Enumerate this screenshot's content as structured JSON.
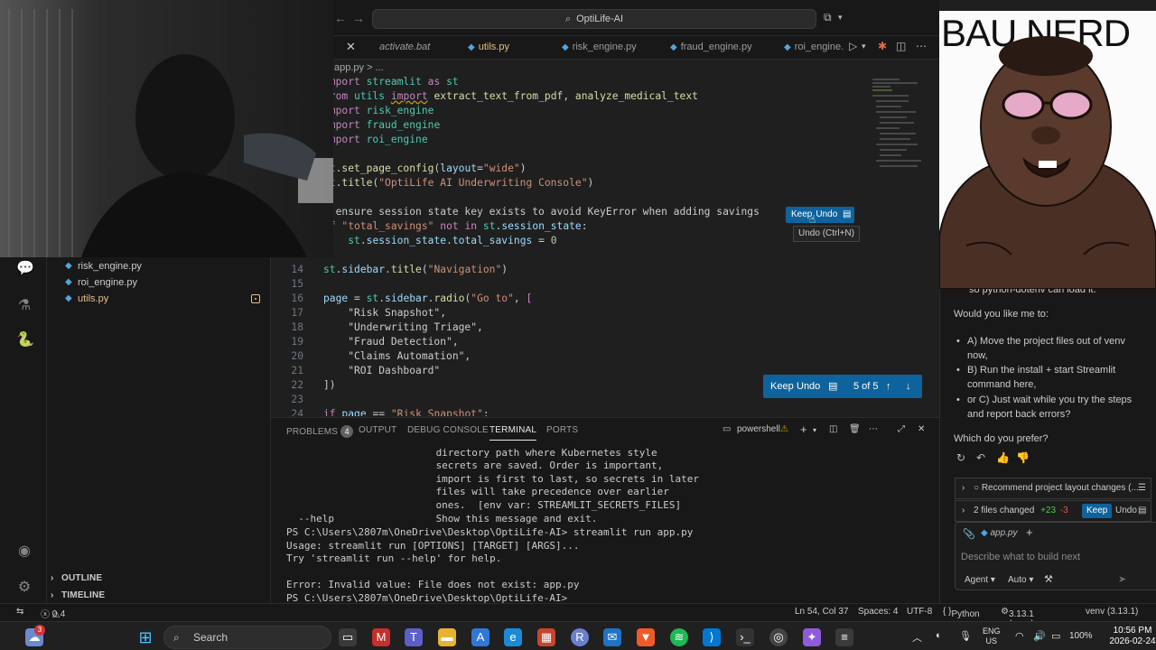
{
  "titlebar": {
    "search_text": "OptiLife-AI"
  },
  "tabs": [
    {
      "label": "activate.bat",
      "italic": true
    },
    {
      "label": "utils.py",
      "modified": true
    },
    {
      "label": "risk_engine.py"
    },
    {
      "label": "fraud_engine.py"
    },
    {
      "label": "roi_engine."
    }
  ],
  "breadcrumb": "app.py > ...",
  "explorer": {
    "files": [
      {
        "name": "risk_engine.py"
      },
      {
        "name": "roi_engine.py"
      },
      {
        "name": "utils.py",
        "modified": true
      }
    ],
    "sections": [
      "OUTLINE",
      "TIMELINE"
    ]
  },
  "editor": {
    "lines": [
      {
        "num": "",
        "code": "import streamlit as st"
      },
      {
        "num": "",
        "code": "from utils import extract_text_from_pdf, analyze_medical_text"
      },
      {
        "num": "",
        "code": "import risk_engine"
      },
      {
        "num": "",
        "code": "import fraud_engine"
      },
      {
        "num": "",
        "code": "import roi_engine"
      },
      {
        "num": "",
        "code": ""
      },
      {
        "num": "",
        "code": "st.set_page_config(layout=\"wide\")"
      },
      {
        "num": "",
        "code": "st.title(\"OptiLife AI Underwriting Console\")"
      },
      {
        "num": "",
        "code": ""
      },
      {
        "num": "",
        "code": "# ensure session state key exists to avoid KeyError when adding savings"
      },
      {
        "num": "",
        "code": "if \"total_savings\" not in st.session_state:"
      },
      {
        "num": "",
        "code": "    st.session_state.total_savings = 0"
      },
      {
        "num": "",
        "code": ""
      },
      {
        "num": "14",
        "code": "st.sidebar.title(\"Navigation\")"
      },
      {
        "num": "15",
        "code": ""
      },
      {
        "num": "16",
        "code": "page = st.sidebar.radio(\"Go to\", ["
      },
      {
        "num": "17",
        "code": "    \"Risk Snapshot\","
      },
      {
        "num": "18",
        "code": "    \"Underwriting Triage\","
      },
      {
        "num": "19",
        "code": "    \"Fraud Detection\","
      },
      {
        "num": "20",
        "code": "    \"Claims Automation\","
      },
      {
        "num": "21",
        "code": "    \"ROI Dashboard\""
      },
      {
        "num": "22",
        "code": "])"
      },
      {
        "num": "23",
        "code": ""
      },
      {
        "num": "24",
        "code": "if page == \"Risk Snapshot\":"
      }
    ],
    "diff_keep_label": "Keep",
    "diff_undo_label": "Undo",
    "tooltip": "Undo (Ctrl+N)",
    "review": {
      "keep": "Keep",
      "undo": "Undo",
      "count": "5 of 5"
    }
  },
  "panel": {
    "tabs": [
      {
        "label": "PROBLEMS",
        "badge": "4"
      },
      {
        "label": "OUTPUT"
      },
      {
        "label": "DEBUG CONSOLE"
      },
      {
        "label": "TERMINAL",
        "active": true
      },
      {
        "label": "PORTS"
      }
    ],
    "shell": "powershell",
    "terminal_lines": [
      "                         directory path where Kubernetes style",
      "                         secrets are saved. Order is important,",
      "                         import is first to last, so secrets in later",
      "                         files will take precedence over earlier",
      "                         ones.  [env var: STREAMLIT_SECRETS_FILES]",
      "  --help                 Show this message and exit.",
      "PS C:\\Users\\2807m\\OneDrive\\Desktop\\OptiLife-AI> streamlit run app.py",
      "Usage: streamlit run [OPTIONS] [TARGET] [ARGS]...",
      "Try 'streamlit run --help' for help.",
      "",
      "Error: Invalid value: File does not exist: app.py",
      "PS C:\\Users\\2807m\\OneDrive\\Desktop\\OptiLife-AI> "
    ]
  },
  "statusbar": {
    "errors": "0",
    "warnings": "4",
    "position": "Ln 54, Col 37",
    "spaces": "Spaces: 4",
    "encoding": "UTF-8",
    "language": "Python",
    "interpreter": "3.13.1 (venv)",
    "venv": "venv (3.13.1)"
  },
  "chat": {
    "partial_line": "so python-dotenv can load it.",
    "question": "Would you like me to:",
    "options": [
      "A) Move the project files out of venv now,",
      "B) Run the install + start Streamlit command here,",
      "or C) Just wait while you try the steps and report back errors?"
    ],
    "prefer": "Which do you prefer?",
    "recommend_row": "Recommend project layout changes (...",
    "changes_row": "2 files changed",
    "added": "+23",
    "removed": "-3",
    "keep": "Keep",
    "undo": "Undo",
    "attachment": "app.py",
    "placeholder": "Describe what to build next",
    "mode": "Agent",
    "model": "Auto"
  },
  "overlay": {
    "avatar_title": "BAU NERD"
  },
  "taskbar": {
    "search": "Search",
    "lang_top": "ENG",
    "lang_bottom": "US",
    "battery": "100%",
    "time": "10:56 PM",
    "date": "2026-02-24",
    "notif_count": "3"
  }
}
